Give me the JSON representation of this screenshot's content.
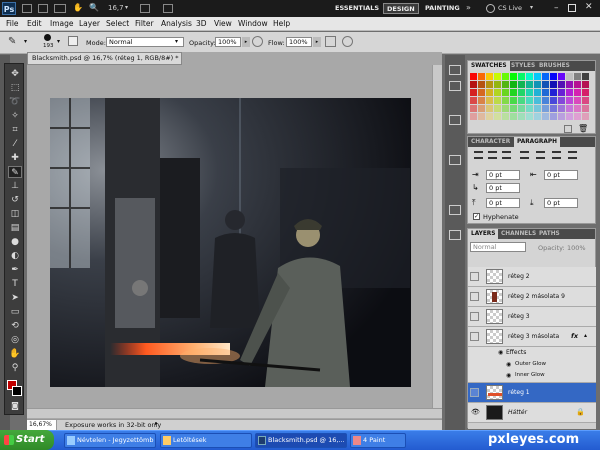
{
  "app": {
    "logo": "Ps",
    "zoom": "16,7",
    "cs_live": "CS Live"
  },
  "workspaces": [
    {
      "label": "ESSENTIALS"
    },
    {
      "label": "DESIGN"
    },
    {
      "label": "PAINTING"
    }
  ],
  "menu": [
    "File",
    "Edit",
    "Image",
    "Layer",
    "Select",
    "Filter",
    "Analysis",
    "3D",
    "View",
    "Window",
    "Help"
  ],
  "options": {
    "brush_size": "193",
    "mode_label": "Mode:",
    "mode_value": "Normal",
    "opacity_label": "Opacity:",
    "opacity_value": "100%",
    "flow_label": "Flow:",
    "flow_value": "100%"
  },
  "document": {
    "tab_title": "Blacksmith.psd @ 16,7% (réteg 1, RGB/8#) *",
    "zoom": "16,67%",
    "status": "Exposure works in 32-bit only"
  },
  "swatches": {
    "tabs": [
      "SWATCHES",
      "STYLES",
      "BRUSHES"
    ]
  },
  "character": {
    "tabs": [
      "CHARACTER",
      "PARAGRAPH"
    ],
    "indent_left": "0 pt",
    "indent_right": "0 pt",
    "first_line": "0 pt",
    "space_before": "0 pt",
    "space_after": "0 pt",
    "hyphenate": "Hyphenate"
  },
  "layers": {
    "tabs": [
      "LAYERS",
      "CHANNELS",
      "PATHS"
    ],
    "blend": "Normal",
    "opacity_label": "Opacity:",
    "opacity_value": "100%",
    "items": [
      {
        "name": "réteg 2"
      },
      {
        "name": "réteg 2 másolata 9"
      },
      {
        "name": "réteg 3"
      },
      {
        "name": "réteg 3 másolata",
        "fx": "fx"
      },
      {
        "name": "Effects"
      },
      {
        "name": "Outer Glow"
      },
      {
        "name": "Inner Glow"
      },
      {
        "name": "réteg 1"
      },
      {
        "name": "Háttér"
      }
    ]
  },
  "taskbar": {
    "start": "Start",
    "tasks": [
      {
        "label": "Névtelen - Jegyzettömb"
      },
      {
        "label": "Letöltések"
      },
      {
        "label": "Blacksmith.psd @ 16,..."
      },
      {
        "label": "4 Paint"
      }
    ]
  },
  "watermark": "pxleyes.com"
}
